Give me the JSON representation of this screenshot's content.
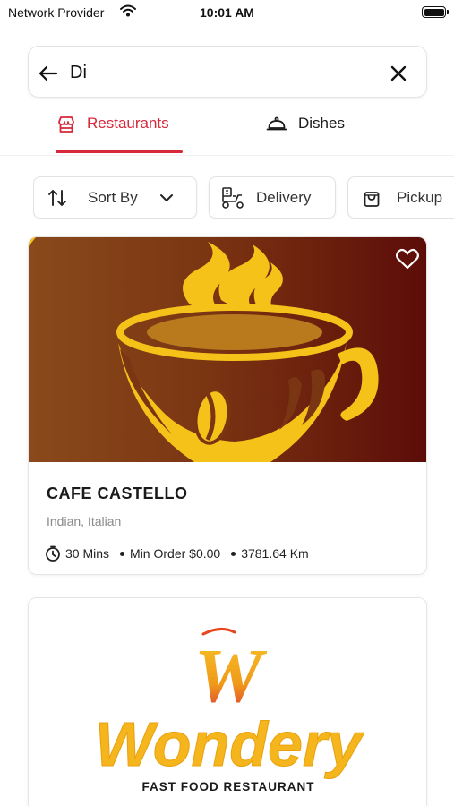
{
  "status_bar": {
    "carrier": "Network Provider",
    "time": "10:01 AM"
  },
  "search": {
    "value": "Di",
    "back_icon": "arrow-left-icon",
    "clear_icon": "close-icon"
  },
  "tabs": [
    {
      "label": "Restaurants",
      "icon": "storefront-icon",
      "active": true
    },
    {
      "label": "Dishes",
      "icon": "cloche-icon",
      "active": false
    }
  ],
  "filters": [
    {
      "label": "Sort By",
      "icon": "sort-arrows-icon"
    },
    {
      "label": "Delivery",
      "icon": "delivery-scooter-icon"
    },
    {
      "label": "Pickup",
      "icon": "shopping-bag-icon"
    }
  ],
  "restaurants": [
    {
      "name": "CAFE CASTELLO",
      "cuisine": "Indian, Italian",
      "time": "30 Mins",
      "min_order": "Min Order $0.00",
      "distance": "3781.64 Km",
      "favorite": false
    },
    {
      "logo_text": "Wondery",
      "logo_letter": "W",
      "logo_tagline": "FAST FOOD RESTAURANT"
    }
  ],
  "colors": {
    "accent": "#d6293a",
    "logo_gold": "#f5b51d",
    "coffee_brown": "#7a3512",
    "coffee_dark": "#5c0c08"
  }
}
